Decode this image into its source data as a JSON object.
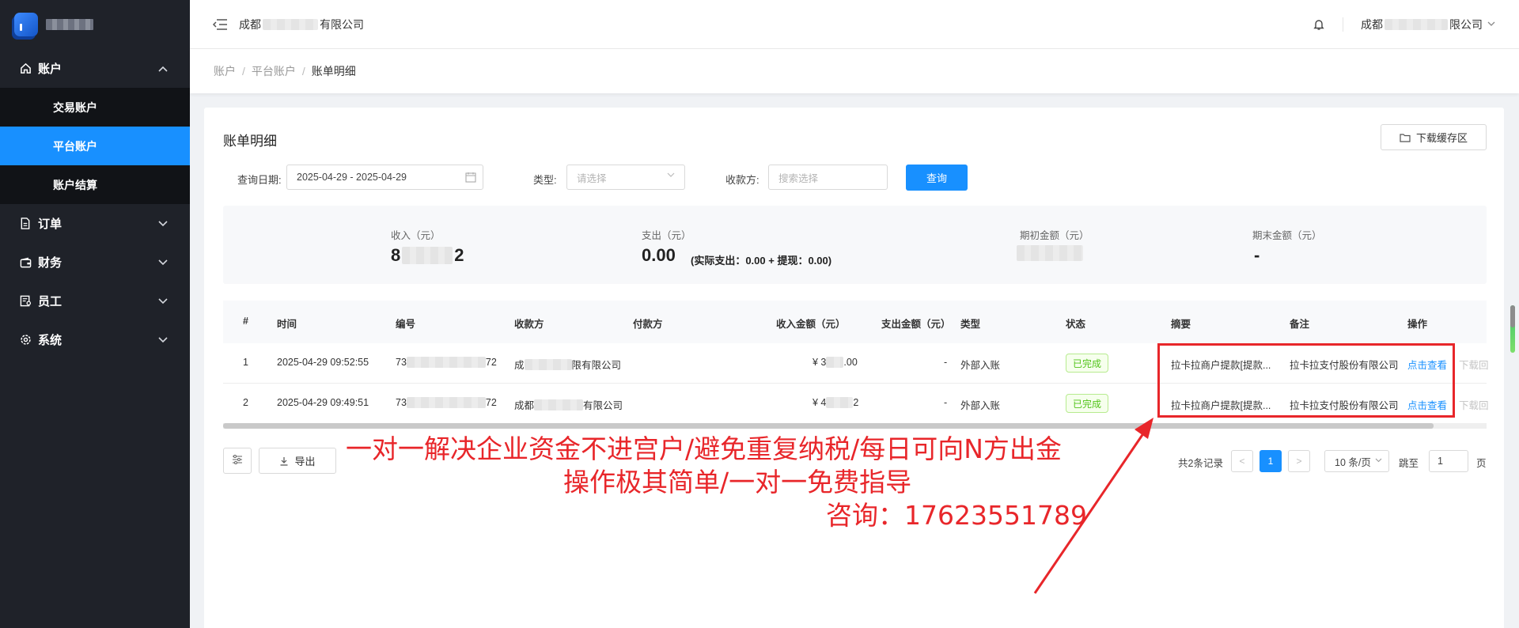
{
  "sidebar": {
    "groups": [
      {
        "label": "账户",
        "icon": "home-icon",
        "expanded": true,
        "items": [
          {
            "label": "交易账户",
            "active": false
          },
          {
            "label": "平台账户",
            "active": true
          },
          {
            "label": "账户结算",
            "active": false
          }
        ]
      },
      {
        "label": "订单",
        "icon": "document-icon"
      },
      {
        "label": "财务",
        "icon": "wallet-icon"
      },
      {
        "label": "员工",
        "icon": "staff-icon"
      },
      {
        "label": "系统",
        "icon": "gear-icon"
      }
    ]
  },
  "header": {
    "company_prefix": "成都",
    "company_suffix": "有限公司",
    "user_company_prefix": "成都",
    "user_company_suffix": "限公司"
  },
  "breadcrumb": [
    "账户",
    "平台账户",
    "账单明细"
  ],
  "page": {
    "title": "账单明细",
    "download_cache_label": "下载缓存区"
  },
  "filters": {
    "date_label": "查询日期:",
    "date_value": "2025-04-29 - 2025-04-29",
    "type_label": "类型:",
    "type_placeholder": "请选择",
    "payee_label": "收款方:",
    "payee_placeholder": "搜索选择",
    "query_label": "查询"
  },
  "summary": {
    "income_label": "收入（元）",
    "income_first": "8",
    "income_last": "2",
    "expense_label": "支出（元）",
    "expense_value": "0.00",
    "expense_note": "(实际支出：0.00 + 提现：0.00)",
    "opening_label": "期初金额（元）",
    "closing_label": "期末金额（元）",
    "closing_value": "-"
  },
  "table": {
    "columns": [
      "#",
      "时间",
      "编号",
      "收款方",
      "付款方",
      "收入金额（元）",
      "支出金额（元）",
      "类型",
      "状态",
      "摘要",
      "备注",
      "操作"
    ],
    "rows": [
      {
        "index": "1",
        "time": "2025-04-29 09:52:55",
        "id_prefix": "73",
        "id_suffix": "72",
        "payee_prefix": "成",
        "payee_suffix": "限有限公司",
        "payer": "",
        "income_prefix": "¥ 3",
        "income_suffix": ".00",
        "expense": "-",
        "type": "外部入账",
        "status": "已完成",
        "summary": "拉卡拉商户提款[提款...",
        "remark": "拉卡拉支付股份有限公司",
        "action": "点击查看",
        "extra_action": "下载回"
      },
      {
        "index": "2",
        "time": "2025-04-29 09:49:51",
        "id_prefix": "73",
        "id_suffix": "72",
        "payee_prefix": "成都",
        "payee_suffix": "有限公司",
        "payer": "",
        "income_prefix": "¥ 4",
        "income_suffix": "2",
        "expense": "-",
        "type": "外部入账",
        "status": "已完成",
        "summary": "拉卡拉商户提款[提款...",
        "remark": "拉卡拉支付股份有限公司",
        "action": "点击查看",
        "extra_action": "下载回"
      }
    ]
  },
  "toolbar": {
    "export_label": "导出"
  },
  "pagination": {
    "total": "共2条记录",
    "prev": "<",
    "current": "1",
    "next": ">",
    "page_size": "10 条/页",
    "jump_label": "跳至",
    "jump_value": "1",
    "page_suffix": "页"
  },
  "overlay": {
    "line1": "一对一解决企业资金不进宫户/避免重复纳税/每日可向N方出金",
    "line2": "操作极其简单/一对一免费指导",
    "line3": "咨询：17623551789",
    "color": "#e8262a"
  },
  "colors": {
    "accent": "#1890ff",
    "sidebar": "#1f2229",
    "success": "#52c41a"
  }
}
